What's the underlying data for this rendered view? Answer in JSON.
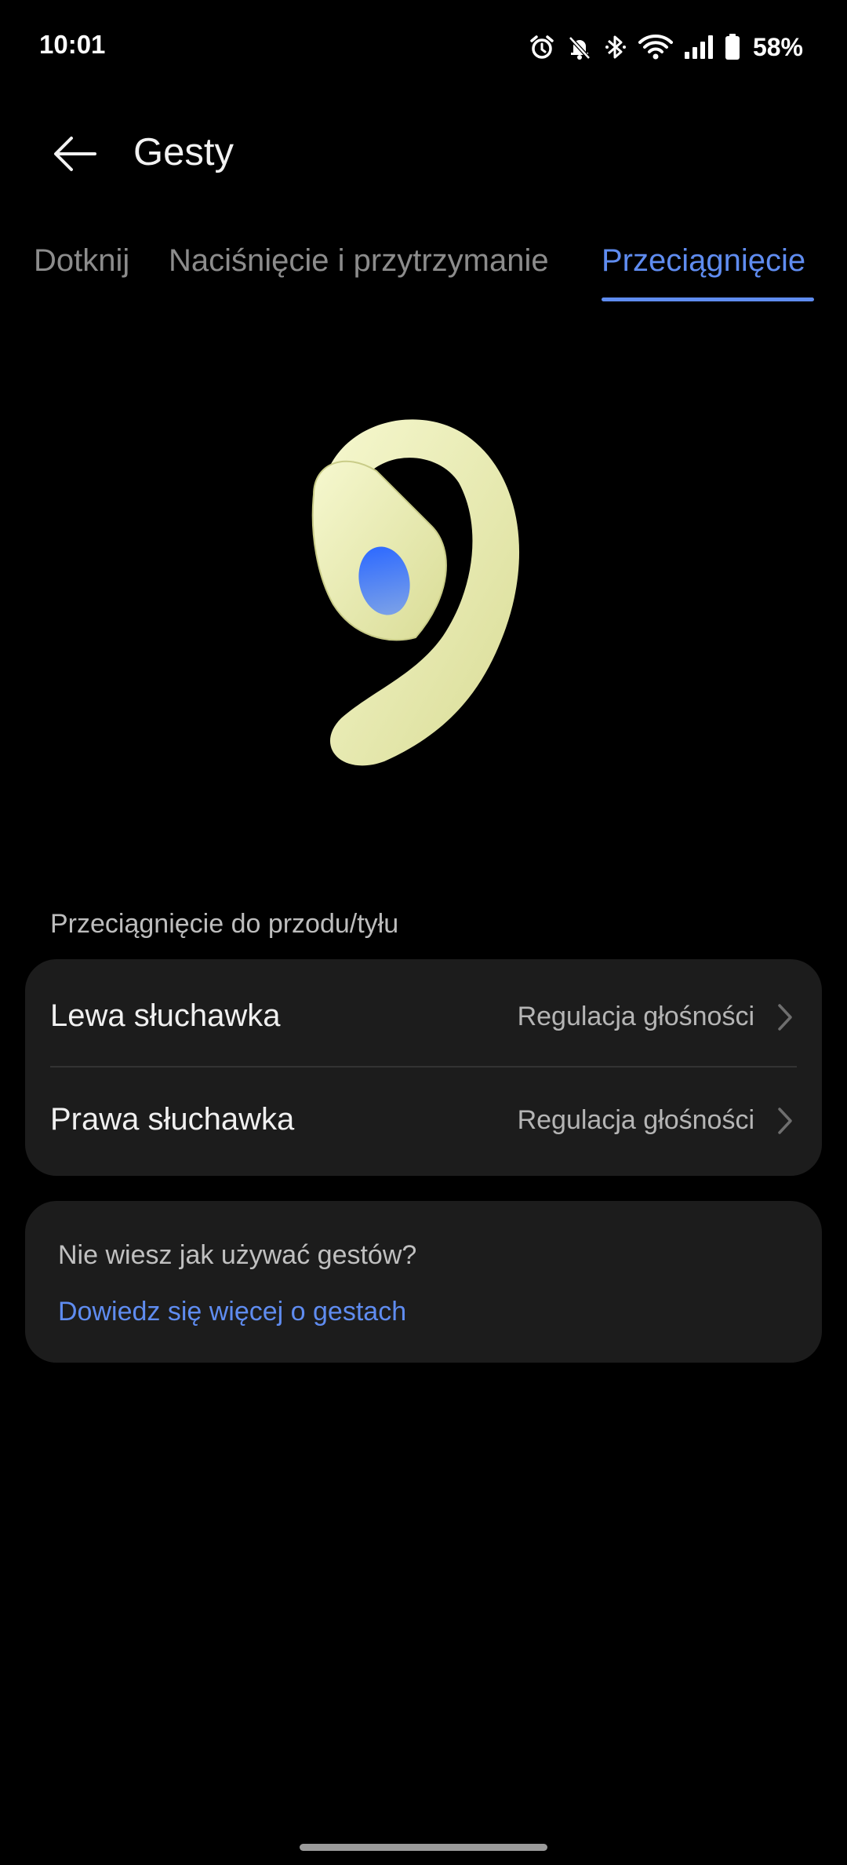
{
  "status_bar": {
    "time": "10:01",
    "battery_percent": "58%",
    "icons": [
      "alarm-icon",
      "bell-off-icon",
      "bluetooth-icon",
      "wifi-icon",
      "signal-icon",
      "battery-icon"
    ]
  },
  "header": {
    "title": "Gesty",
    "back_icon": "arrow-left-icon"
  },
  "tabs": [
    {
      "label": "Dotknij",
      "active": false
    },
    {
      "label": "Naciśnięcie i przytrzymanie",
      "active": false
    },
    {
      "label": "Przeciągnięcie",
      "active": true
    }
  ],
  "colors": {
    "background": "#000000",
    "card": "#1c1c1c",
    "accent": "#5f8cf0",
    "earbud": "#eef0b8"
  },
  "section": {
    "header": "Przeciągnięcie do przodu/tyłu",
    "rows": [
      {
        "label": "Lewa słuchawka",
        "value": "Regulacja głośności"
      },
      {
        "label": "Prawa słuchawka",
        "value": "Regulacja głośności"
      }
    ]
  },
  "help": {
    "text": "Nie wiesz jak używać gestów?",
    "link": "Dowiedz się więcej o gestach"
  }
}
